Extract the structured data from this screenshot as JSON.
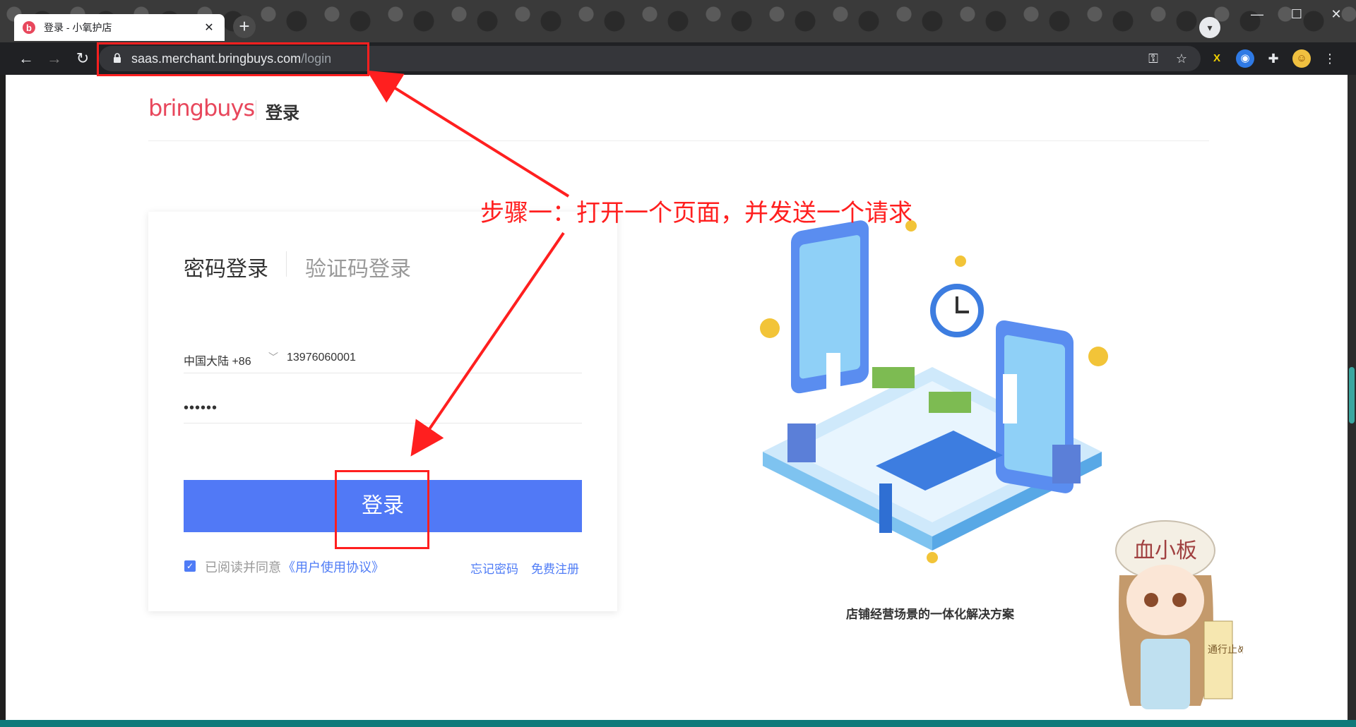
{
  "browser": {
    "tab_title": "登录 - 小氧护店",
    "tab_favicon_letter": "b",
    "tab_close": "✕",
    "new_tab": "+",
    "url_host": "saas.merchant.bringbuys.com",
    "url_path": "/login",
    "window_minimize": "—",
    "window_maximize": "☐",
    "window_close": "✕"
  },
  "header": {
    "logo": "bringbuys",
    "title": "登录"
  },
  "login": {
    "tab_password": "密码登录",
    "tab_code": "验证码登录",
    "region": "中国大陆 +86",
    "phone": "13976060001",
    "password_mask": "••••••",
    "submit": "登录",
    "agree_text": "已阅读并同意",
    "agreement_link": "《用户使用协议》",
    "forgot_password": "忘记密码",
    "register": "免费注册"
  },
  "hero": {
    "caption": "店铺经营场景的一体化解决方案"
  },
  "annotation": {
    "text": "步骤一：打开一个页面，并发送一个请求",
    "color": "#ff1f1f"
  },
  "mascot": {
    "hat_text": "血小板",
    "flag_text": "通行止め"
  },
  "colors": {
    "primary": "#5179f6",
    "brand": "#e8475c",
    "annotation": "#ff1f1f"
  }
}
